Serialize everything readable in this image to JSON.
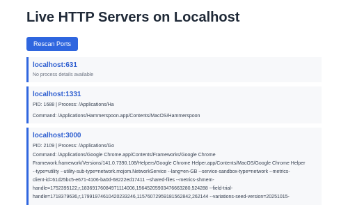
{
  "page": {
    "title": "Live HTTP Servers on Localhost",
    "rescan_label": "Rescan Ports"
  },
  "servers": [
    {
      "name": "localhost:631",
      "no_details": "No process details available"
    },
    {
      "name": "localhost:1331",
      "pid_line": "PID: 1688 | Process: /Applications/Ha",
      "command_line": "Command: /Applications/Hammerspoon.app/Contents/MacOS/Hammerspoon"
    },
    {
      "name": "localhost:3000",
      "pid_line": "PID: 2109 | Process: /Applications/Go",
      "command_lines": [
        "Command: /Applications/Google Chrome.app/Contents/Frameworks/Google Chrome",
        "Framework.framework/Versions/141.0.7390.108/Helpers/Google Chrome Helper.app/Contents/MacOS/Google Chrome Helper",
        "--type=utility --utility-sub-type=network.mojom.NetworkService --lang=en-GB --service-sandbox-type=network --metrics-",
        "client-id=61d25bc5-e671-4106-ba0d-68222ed17411 --shared-files --metrics-shmem-",
        "handle=1752395122,r,1836917608497111400​6,15645205903476663280,524288 --field-trial-",
        "handle=1718379636,r,17991974610420233246,11576072959181562842,262144 --variations-seed-version=20251015-"
      ]
    }
  ]
}
